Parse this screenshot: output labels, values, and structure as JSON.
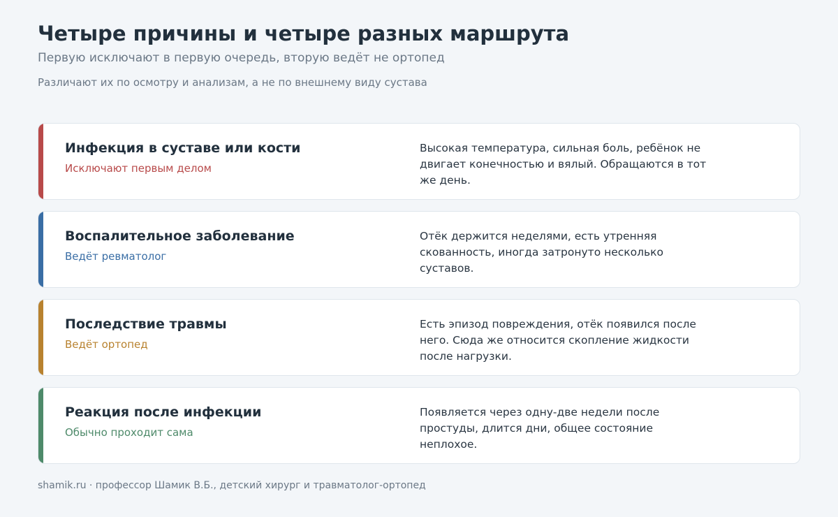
{
  "header": {
    "title": "Четыре причины и четыре разных маршрута",
    "subtitle": "Первую исключают в первую очередь, вторую ведёт не ортопед",
    "note": "Различают их по осмотру и анализам, а не по внешнему виду сустава"
  },
  "cards": [
    {
      "title": "Инфекция в суставе или кости",
      "route": "Исключают первым делом",
      "description": "Высокая температура, сильная боль, ребёнок не двигает конечностью и вялый. Обращаются в тот же день.",
      "accent_color": "#b84a4a"
    },
    {
      "title": "Воспалительное заболевание",
      "route": "Ведёт ревматолог",
      "description": "Отёк держится неделями, есть утренняя скованность, иногда затронуто несколько суставов.",
      "accent_color": "#3a6ea5"
    },
    {
      "title": "Последствие травмы",
      "route": "Ведёт ортопед",
      "description": "Есть эпизод повреждения, отёк появился после него. Сюда же относится скопление жидкости после нагрузки.",
      "accent_color": "#b8822f"
    },
    {
      "title": "Реакция после инфекции",
      "route": "Обычно проходит сама",
      "description": "Появляется через одну-две недели после простуды, длится дни, общее состояние неплохое.",
      "accent_color": "#4e8a6a"
    }
  ],
  "footer": {
    "text": "shamik.ru · профессор Шамик В.Б., детский хирург и травматолог-ортопед"
  }
}
